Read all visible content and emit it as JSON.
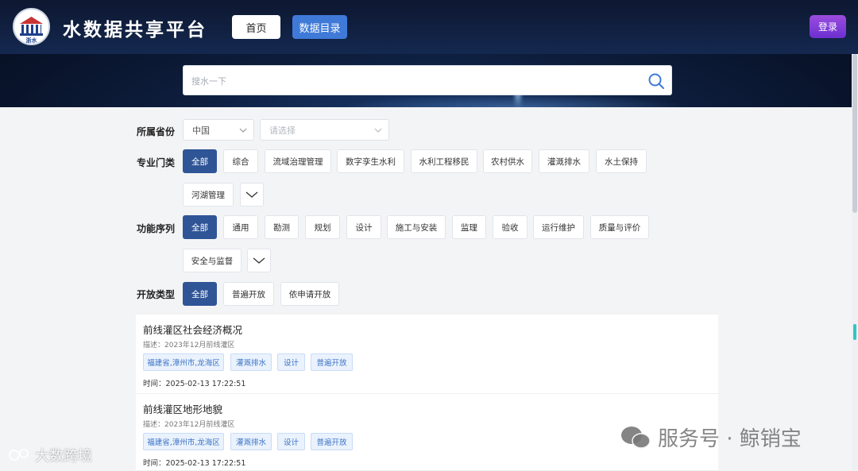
{
  "header": {
    "logo_text": "浙水",
    "site_title": "水数据共享平台",
    "nav": [
      {
        "label": "首页"
      },
      {
        "label": "数据目录"
      }
    ],
    "login_label": "登录"
  },
  "search": {
    "placeholder": "搜水一下"
  },
  "filters": {
    "province": {
      "label": "所属省份",
      "country_value": "中国",
      "region_placeholder": "请选择"
    },
    "specialty": {
      "label": "专业门类",
      "options": [
        "全部",
        "综合",
        "流域治理管理",
        "数字孪生水利",
        "水利工程移民",
        "农村供水",
        "灌溉排水",
        "水土保持",
        "河湖管理"
      ]
    },
    "function": {
      "label": "功能序列",
      "options": [
        "全部",
        "通用",
        "勘测",
        "规划",
        "设计",
        "施工与安装",
        "监理",
        "验收",
        "运行维护",
        "质量与评价",
        "安全与监督"
      ]
    },
    "open_type": {
      "label": "开放类型",
      "options": [
        "全部",
        "普遍开放",
        "依申请开放"
      ]
    }
  },
  "results": [
    {
      "title": "前线灌区社会经济概况",
      "desc": "描述：2023年12月前线灌区",
      "tags": [
        "福建省,漳州市,龙海区",
        "灌溉排水",
        "设计",
        "普遍开放"
      ],
      "time": "时间：2025-02-13 17:22:51"
    },
    {
      "title": "前线灌区地形地貌",
      "desc": "描述：2023年12月前线灌区",
      "tags": [
        "福建省,漳州市,龙海区",
        "灌溉排水",
        "设计",
        "普遍开放"
      ],
      "time": "时间：2025-02-13 17:22:51"
    }
  ],
  "watermarks": {
    "left": "大数跨境",
    "right": "服务号 · 鲸销宝"
  },
  "colors": {
    "active_chip": "#2f5597",
    "catalog_button": "#3f7ad8",
    "login_button": "#7b3dd6",
    "tag_text": "#3b73c6"
  }
}
